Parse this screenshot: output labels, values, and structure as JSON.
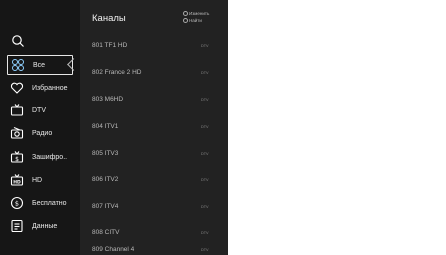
{
  "sidebar": {
    "items": [
      {
        "label": "Все",
        "icon": "grid-icon"
      },
      {
        "label": "Избранное",
        "icon": "heart-icon"
      },
      {
        "label": "DTV",
        "icon": "tv-icon"
      },
      {
        "label": "Радио",
        "icon": "radio-icon"
      },
      {
        "label": "Зашифро..",
        "icon": "dollar-tv-icon"
      },
      {
        "label": "HD",
        "icon": "hd-tv-icon"
      },
      {
        "label": "Бесплатно",
        "icon": "free-icon"
      },
      {
        "label": "Данные",
        "icon": "data-icon"
      }
    ],
    "active": "Все"
  },
  "channels": {
    "title": "Каналы",
    "hint_edit": "Изменить",
    "hint_find": "Найти",
    "list": [
      {
        "name": "801 TF1 HD",
        "tag": "DTV"
      },
      {
        "name": "802 France 2 HD",
        "tag": "DTV"
      },
      {
        "name": "803 M6HD",
        "tag": "DTV"
      },
      {
        "name": "804 ITV1",
        "tag": "DTV"
      },
      {
        "name": "805 ITV3",
        "tag": "DTV"
      },
      {
        "name": "806 ITV2",
        "tag": "DTV"
      },
      {
        "name": "807 ITV4",
        "tag": "DTV"
      },
      {
        "name": "808 CITV",
        "tag": "DTV"
      },
      {
        "name": "809 Channel 4",
        "tag": "DTV"
      }
    ]
  }
}
